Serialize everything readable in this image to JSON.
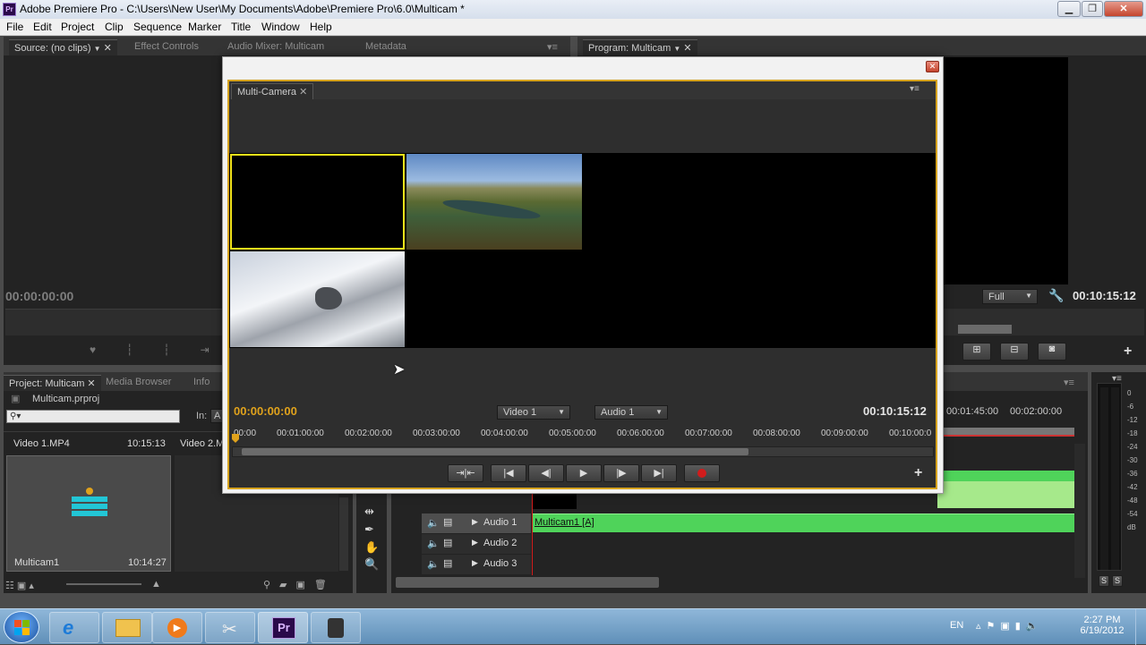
{
  "window": {
    "title": "Adobe Premiere Pro - C:\\Users\\New User\\My Documents\\Adobe\\Premiere Pro\\6.0\\Multicam *",
    "app_icon": "Pr"
  },
  "menu": [
    "File",
    "Edit",
    "Project",
    "Clip",
    "Sequence",
    "Marker",
    "Title",
    "Window",
    "Help"
  ],
  "source_panel": {
    "tabs": [
      "Source: (no clips)",
      "Effect Controls",
      "Audio Mixer: Multicam",
      "Metadata"
    ],
    "timecode": "00:00:00:00"
  },
  "program_panel": {
    "tab": "Program: Multicam",
    "zoom": "Full",
    "timecode": "00:10:15:12"
  },
  "project_panel": {
    "tabs": [
      "Project: Multicam",
      "Media Browser",
      "Info"
    ],
    "file": "Multicam.prproj",
    "in_label": "In:",
    "in_value": "A",
    "clips": [
      {
        "name": "Video 1.MP4",
        "duration": "10:15:13"
      },
      {
        "name": "Video 2.M",
        "duration": ""
      }
    ],
    "sequence": {
      "name": "Multicam1",
      "duration": "10:14:27"
    }
  },
  "timeline": {
    "ruler": [
      "00:01:45:00",
      "00:02:00:00"
    ],
    "tracks": [
      {
        "name": "Audio 1",
        "clip": "Multicam1 [A]"
      },
      {
        "name": "Audio 2",
        "clip": ""
      },
      {
        "name": "Audio 3",
        "clip": ""
      }
    ]
  },
  "meter": {
    "scale": [
      "0",
      "-6",
      "-12",
      "-18",
      "-24",
      "-30",
      "-36",
      "-42",
      "-48",
      "-54",
      "dB"
    ],
    "buttons": [
      "S",
      "S"
    ]
  },
  "multicam": {
    "tab": "Multi-Camera",
    "timecode_current": "00:00:00:00",
    "timecode_end": "00:10:15:12",
    "video_select": "Video 1",
    "audio_select": "Audio 1",
    "ruler": [
      "00:00",
      "00:01:00:00",
      "00:02:00:00",
      "00:03:00:00",
      "00:04:00:00",
      "00:05:00:00",
      "00:06:00:00",
      "00:07:00:00",
      "00:08:00:00",
      "00:09:00:00",
      "00:10:00:0"
    ],
    "add_label": "+"
  },
  "tray": {
    "lang": "EN",
    "time": "2:27 PM",
    "date": "6/19/2012"
  },
  "colors": {
    "accent": "#e0a21c",
    "clip_green": "#4fd35a",
    "clip_light": "#a6e98b",
    "record_red": "#d11c1c",
    "selected_border": "#f2e21a"
  }
}
